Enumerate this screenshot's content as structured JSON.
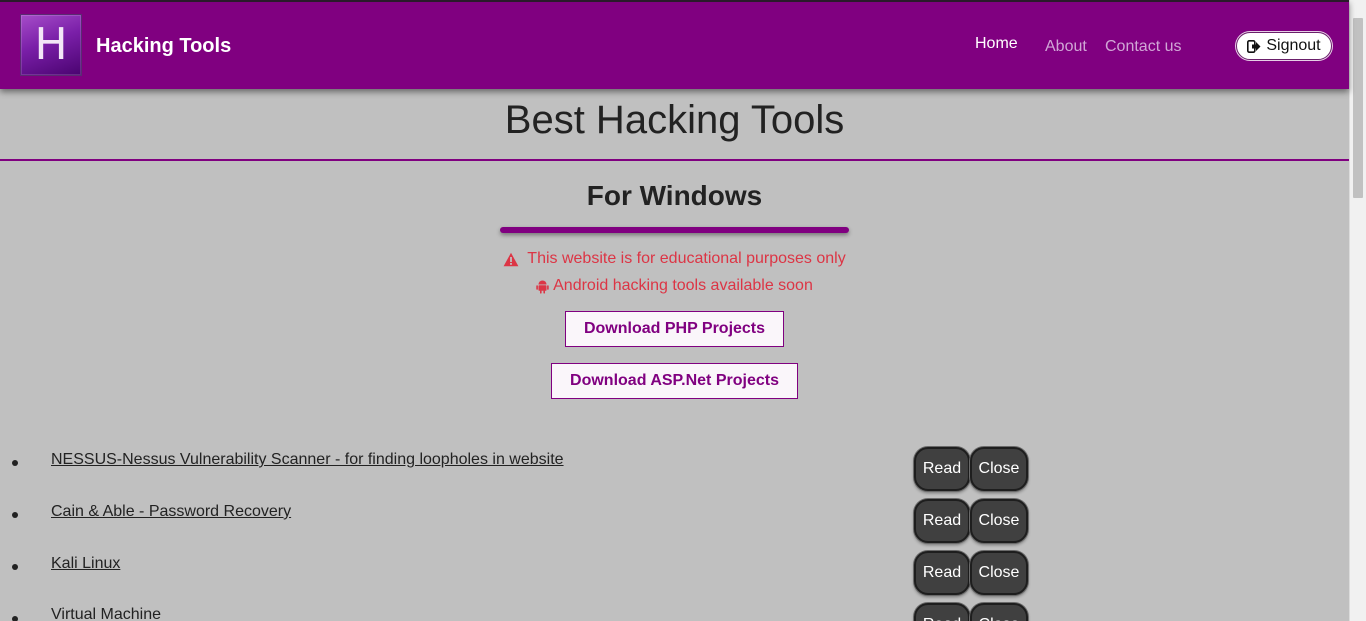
{
  "nav": {
    "logo_letter": "H",
    "brand": "Hacking Tools",
    "links": [
      "Home",
      "About",
      "Contact us"
    ],
    "signout_label": "Signout"
  },
  "main": {
    "title": "Best Hacking Tools",
    "section_title": "For Windows",
    "notice_warning": "This website is for educational purposes only",
    "notice_android": "Android hacking tools available soon",
    "download_php": "Download PHP Projects",
    "download_asp": "Download ASP.Net Projects"
  },
  "tools": [
    {
      "name": "NESSUS-Nessus Vulnerability Scanner - for finding loopholes in website",
      "read": "Read",
      "close": "Close"
    },
    {
      "name": "Cain & Able - Password Recovery",
      "read": "Read",
      "close": "Close"
    },
    {
      "name": "Kali Linux",
      "read": "Read",
      "close": "Close"
    },
    {
      "name": "Virtual Machine",
      "read": "Read",
      "close": "Close"
    }
  ],
  "colors": {
    "primary": "#800080",
    "page_bg": "#c0c0c0",
    "alert": "#dc3545",
    "pill_bg": "#404040"
  },
  "icons": [
    "warning-icon",
    "android-icon",
    "signout-icon"
  ]
}
